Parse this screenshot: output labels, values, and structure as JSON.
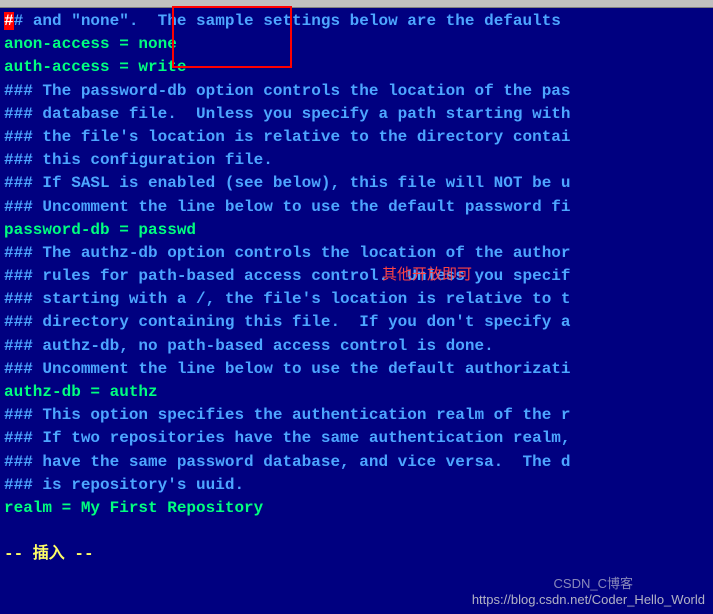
{
  "lines": [
    {
      "cls": "comment",
      "prefix_cursor": true,
      "text": "## and \"none\".  The sample settings below are the defaults"
    },
    {
      "cls": "setting",
      "text": "anon-access = none"
    },
    {
      "cls": "setting",
      "text": "auth-access = write"
    },
    {
      "cls": "comment",
      "text": "### The password-db option controls the location of the pas"
    },
    {
      "cls": "comment",
      "text": "### database file.  Unless you specify a path starting with"
    },
    {
      "cls": "comment",
      "text": "### the file's location is relative to the directory contai"
    },
    {
      "cls": "comment",
      "text": "### this configuration file."
    },
    {
      "cls": "comment",
      "text": "### If SASL is enabled (see below), this file will NOT be u"
    },
    {
      "cls": "comment",
      "text": "### Uncomment the line below to use the default password fi"
    },
    {
      "cls": "setting",
      "text": "password-db = passwd"
    },
    {
      "cls": "comment",
      "text": "### The authz-db option controls the location of the author"
    },
    {
      "cls": "comment",
      "text": "### rules for path-based access control.  Unless you specif"
    },
    {
      "cls": "comment",
      "text": "### starting with a /, the file's location is relative to t"
    },
    {
      "cls": "comment",
      "text": "### directory containing this file.  If you don't specify a"
    },
    {
      "cls": "comment",
      "text": "### authz-db, no path-based access control is done."
    },
    {
      "cls": "comment",
      "text": "### Uncomment the line below to use the default authorizati"
    },
    {
      "cls": "setting",
      "text": "authz-db = authz"
    },
    {
      "cls": "comment",
      "text": "### This option specifies the authentication realm of the r"
    },
    {
      "cls": "comment",
      "text": "### If two repositories have the same authentication realm,"
    },
    {
      "cls": "comment",
      "text": "### have the same password database, and vice versa.  The d"
    },
    {
      "cls": "comment",
      "text": "### is repository's uuid."
    },
    {
      "cls": "setting",
      "text": "realm = My First Repository"
    },
    {
      "cls": "blank",
      "text": ""
    },
    {
      "cls": "insert-mode",
      "text": "-- 插入 --"
    }
  ],
  "annotation": "其他开放即可",
  "watermark_url": "https://blog.csdn.net/Coder_Hello_World",
  "watermark_logo": "CSDN_C博客"
}
